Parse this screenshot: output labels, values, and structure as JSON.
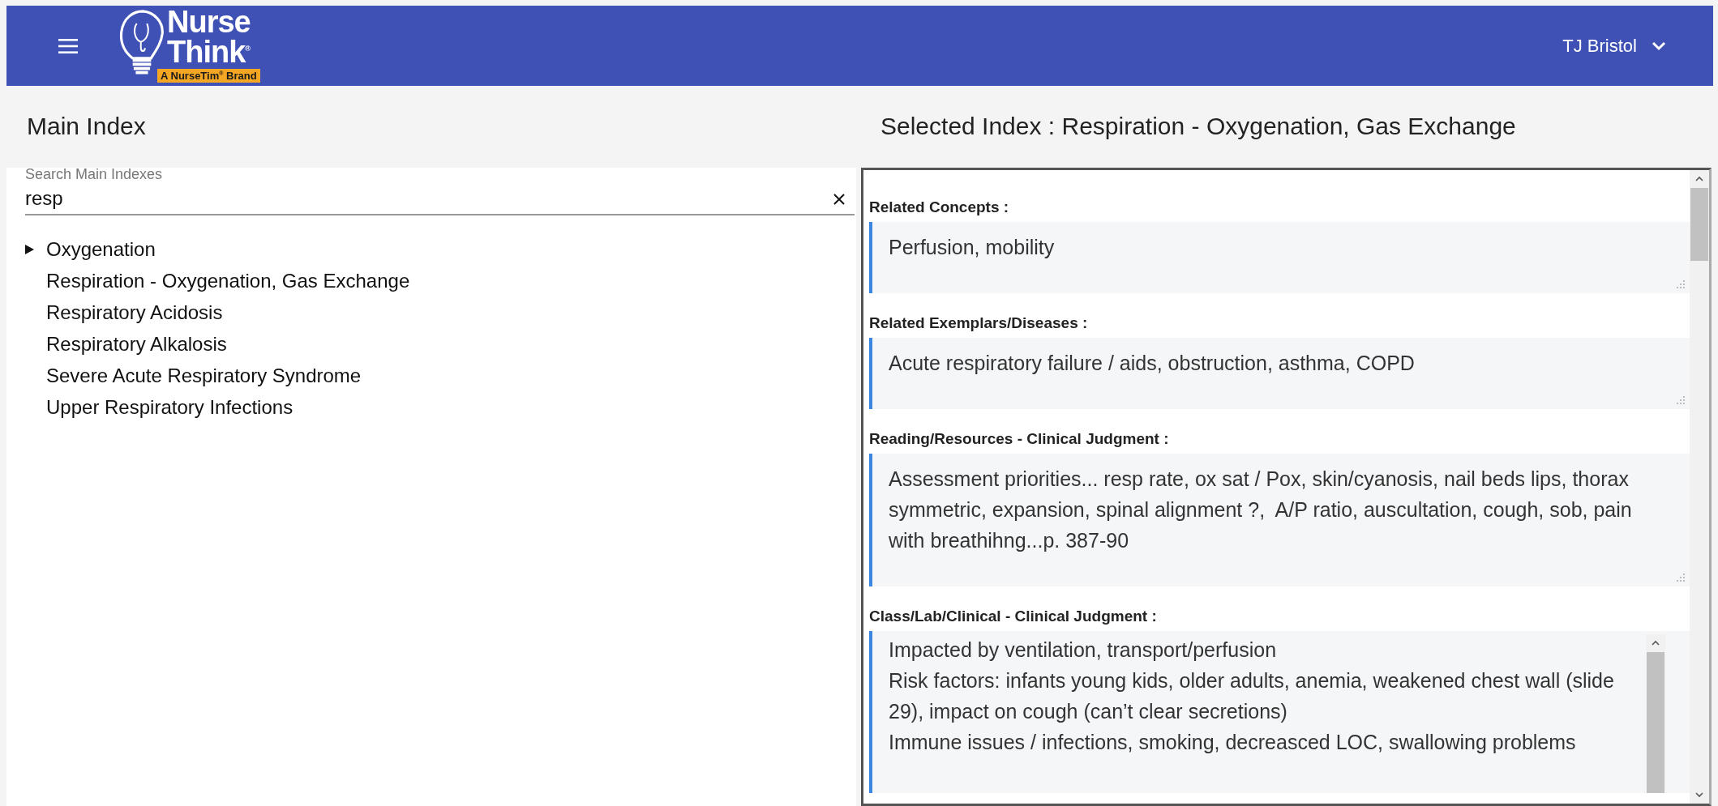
{
  "header": {
    "logo": {
      "line_1": "Nurse",
      "line_2": "Think$^{®}$",
      "tagline": "A NurseTim$^{®}$ Brand"
    },
    "user": "TJ Bristol"
  },
  "main_index": {
    "title": "Main Index",
    "search": {
      "label": "Search Main Indexes",
      "value": "resp"
    },
    "items": [
      {
        "label": "Oxygenation",
        "expandable": true
      },
      {
        "label": "Respiration - Oxygenation, Gas Exchange",
        "expandable": false
      },
      {
        "label": "Respiratory Acidosis",
        "expandable": false
      },
      {
        "label": "Respiratory Alkalosis",
        "expandable": false
      },
      {
        "label": "Severe Acute Respiratory Syndrome",
        "expandable": false
      },
      {
        "label": "Upper Respiratory Infections",
        "expandable": false
      }
    ]
  },
  "selected_index": {
    "title": "Selected Index : Respiration - Oxygenation, Gas Exchange",
    "sections": [
      {
        "label": "Related Concepts :",
        "lines": [
          "Perfusion, mobility"
        ],
        "scrollable": false
      },
      {
        "label": "Related Exemplars/Diseases :",
        "lines": [
          "Acute respiratory failure / aids, obstruction, asthma, COPD"
        ],
        "scrollable": false
      },
      {
        "label": "Reading/Resources - Clinical Judgment :",
        "lines": [
          "Assessment priorities... resp rate, ox sat / Pox, skin/cyanosis, nail beds lips, thorax symmetric, expansion, spinal alignment ?,  A/P ratio, auscultation, cough, sob, pain with breathihng...p. 387-90"
        ],
        "scrollable": false
      },
      {
        "label": "Class/Lab/Clinical - Clinical Judgment :",
        "lines": [
          "Impacted by ventilation, transport/perfusion",
          "Risk factors: infants young kids, older adults, anemia, weakened chest wall (slide 29), impact on cough (can’t clear secretions)",
          "Immune issues / infections, smoking, decreasced LOC, swallowing problems"
        ],
        "scrollable": true
      }
    ]
  }
}
